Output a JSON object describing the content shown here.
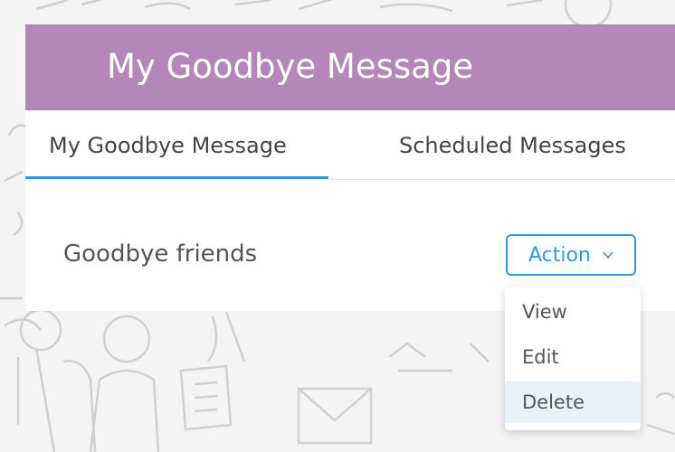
{
  "header": {
    "title": "My Goodbye Message"
  },
  "tabs": [
    {
      "label": "My Goodbye Message",
      "active": true
    },
    {
      "label": "Scheduled Messages",
      "active": false
    }
  ],
  "message": {
    "title": "Goodbye friends",
    "action_label": "Action"
  },
  "action_menu": {
    "items": [
      {
        "label": "View"
      },
      {
        "label": "Edit"
      },
      {
        "label": "Delete",
        "highlighted": true
      }
    ]
  },
  "colors": {
    "header_bg": "#b487b9",
    "accent": "#2e9be0",
    "highlight_bg": "#e6f3fb"
  }
}
